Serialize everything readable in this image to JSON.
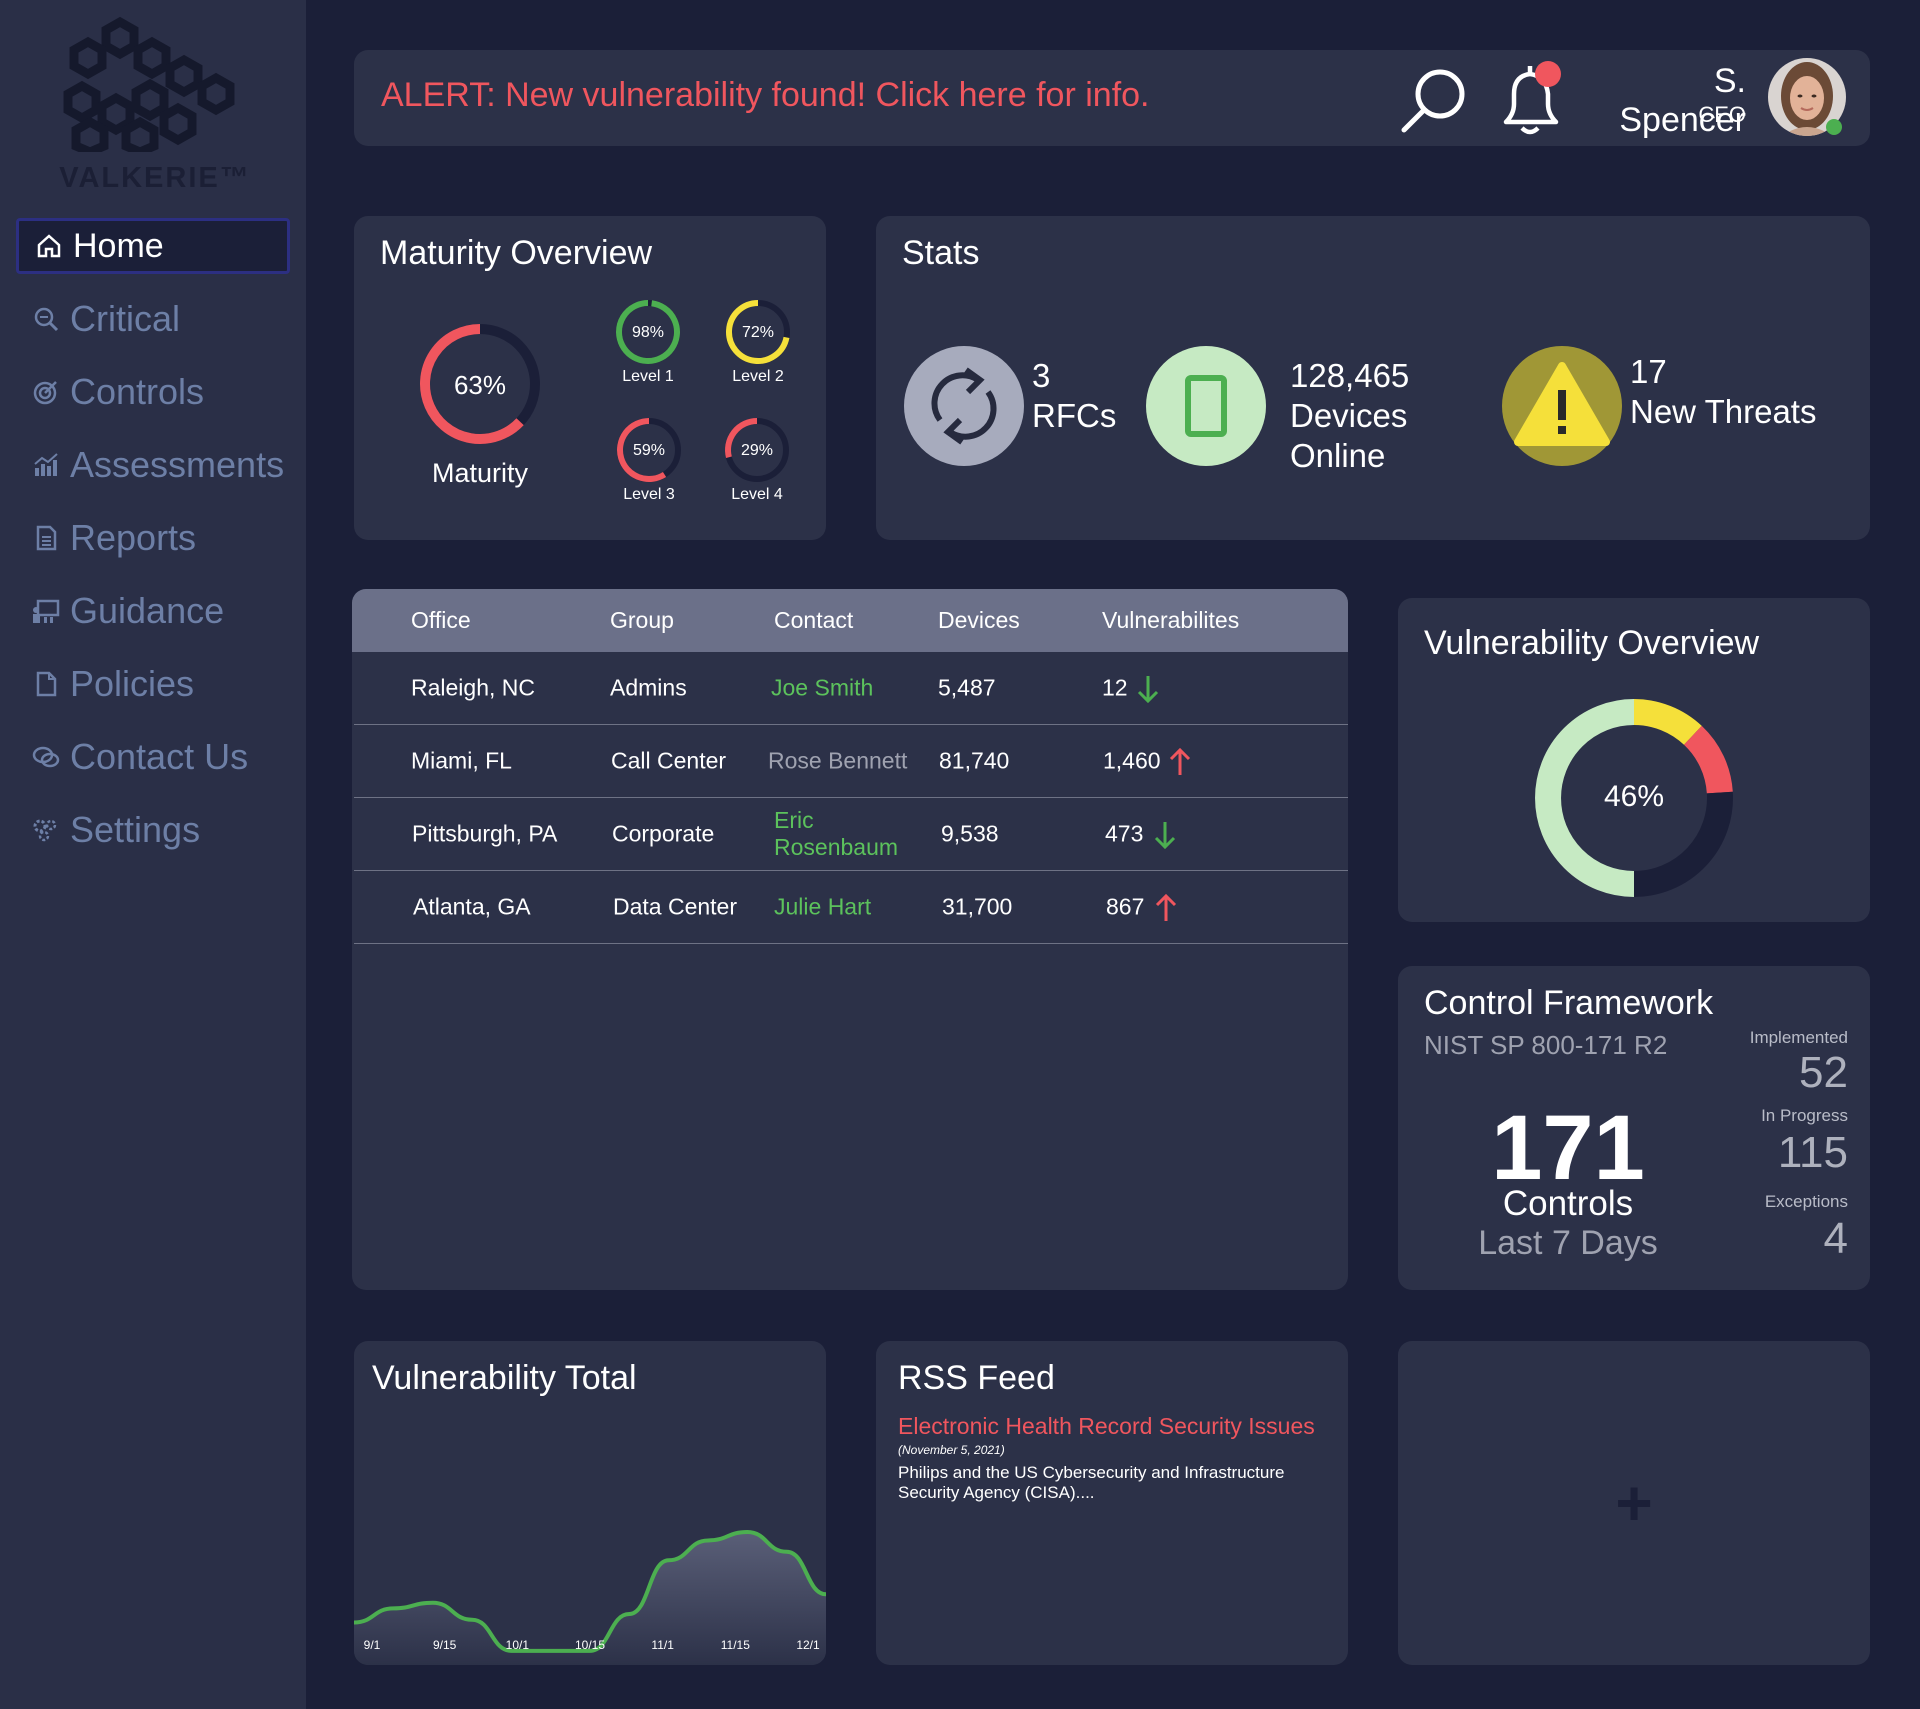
{
  "brand": {
    "name": "VALKERIE™"
  },
  "sidebar": {
    "items": [
      {
        "label": "Home",
        "icon": "home-icon",
        "active": true
      },
      {
        "label": "Critical",
        "icon": "critical-search-icon"
      },
      {
        "label": "Controls",
        "icon": "target-icon"
      },
      {
        "label": "Assessments",
        "icon": "bar-chart-icon"
      },
      {
        "label": "Reports",
        "icon": "report-document-icon"
      },
      {
        "label": "Guidance",
        "icon": "guidance-board-icon"
      },
      {
        "label": "Policies",
        "icon": "page-icon"
      },
      {
        "label": "Contact Us",
        "icon": "chat-bubbles-icon"
      },
      {
        "label": "Settings",
        "icon": "gears-icon"
      }
    ]
  },
  "header": {
    "alert": "ALERT: New vulnerability found! Click here for info.",
    "user_name": "S. Spencer",
    "user_role": "CEO",
    "notification_dot_color": "#f0565e",
    "online_dot_color": "#4caf50"
  },
  "maturity": {
    "title": "Maturity Overview",
    "main": {
      "value": "63%",
      "label": "Maturity",
      "fraction": 0.63,
      "color": "#f0565e"
    },
    "levels": [
      {
        "value": "98%",
        "label": "Level 1",
        "fraction": 0.98,
        "color": "#4caf50"
      },
      {
        "value": "72%",
        "label": "Level 2",
        "fraction": 0.72,
        "color": "#f5e03a"
      },
      {
        "value": "59%",
        "label": "Level 3",
        "fraction": 0.59,
        "color": "#f0565e"
      },
      {
        "value": "29%",
        "label": "Level 4",
        "fraction": 0.29,
        "color": "#f0565e"
      }
    ]
  },
  "stats": {
    "title": "Stats",
    "rfcs": {
      "count": "3",
      "label": "RFCs"
    },
    "devices": {
      "count": "128,465",
      "label1": "Devices",
      "label2": "Online"
    },
    "threats": {
      "count": "17",
      "label": "New Threats"
    }
  },
  "table": {
    "headers": [
      "Office",
      "Group",
      "Contact",
      "Devices",
      "Vulnerabilites"
    ],
    "rows": [
      {
        "office": "Raleigh, NC",
        "group": "Admins",
        "contact": "Joe Smith",
        "contact_style": "green",
        "devices": "5,487",
        "vulns": "12",
        "trend": "down"
      },
      {
        "office": "Miami, FL",
        "group": "Call Center",
        "contact": "Rose Bennett",
        "contact_style": "gray",
        "devices": "81,740",
        "vulns": "1,460",
        "trend": "up"
      },
      {
        "office": "Pittsburgh, PA",
        "group": "Corporate",
        "contact": "Eric Rosenbaum",
        "contact_line1": "Eric",
        "contact_line2": "Rosenbaum",
        "contact_style": "green",
        "devices": "9,538",
        "vulns": "473",
        "trend": "down"
      },
      {
        "office": "Atlanta, GA",
        "group": "Data Center",
        "contact": "Julie Hart",
        "contact_style": "green",
        "devices": "31,700",
        "vulns": "867",
        "trend": "up"
      }
    ],
    "trend_colors": {
      "down": "#4caf50",
      "up": "#f0565e"
    }
  },
  "vulnerability_overview": {
    "title": "Vulnerability Overview",
    "center": "46%",
    "segments": [
      {
        "fraction": 0.5,
        "color": "#c6eac3"
      },
      {
        "fraction": 0.12,
        "color": "#f5e03a"
      },
      {
        "fraction": 0.12,
        "color": "#f0565e"
      },
      {
        "fraction": 0.26,
        "color": "#1b1f38"
      }
    ]
  },
  "control_framework": {
    "title": "Control Framework",
    "subtitle": "NIST SP 800-171 R2",
    "total": "171",
    "total_label": "Controls",
    "period": "Last 7 Days",
    "implemented_label": "Implemented",
    "implemented": "52",
    "in_progress_label": "In Progress",
    "in_progress": "115",
    "exceptions_label": "Exceptions",
    "exceptions": "4"
  },
  "vulnerability_total": {
    "title": "Vulnerability Total",
    "chart_data": {
      "type": "area",
      "x": [
        "9/1",
        "9/8",
        "9/15",
        "9/22",
        "10/1",
        "10/8",
        "10/15",
        "10/22",
        "11/1",
        "11/8",
        "11/15",
        "11/22",
        "12/1"
      ],
      "y": [
        30,
        40,
        44,
        32,
        10,
        10,
        10,
        36,
        74,
        88,
        94,
        80,
        50
      ],
      "ylim": [
        0,
        130
      ],
      "tick_labels": [
        "9/1",
        "9/15",
        "10/1",
        "10/15",
        "11/1",
        "11/15",
        "12/1"
      ],
      "line_color": "#4caf50",
      "xlabel": "",
      "ylabel": ""
    }
  },
  "rss": {
    "title": "RSS Feed",
    "headline": "Electronic Health Record Security Issues",
    "date": "(November 5, 2021)",
    "body": "Philips and the US Cybersecurity and Infrastructure Security Agency (CISA)...."
  },
  "add_widget": {
    "symbol": "+"
  }
}
